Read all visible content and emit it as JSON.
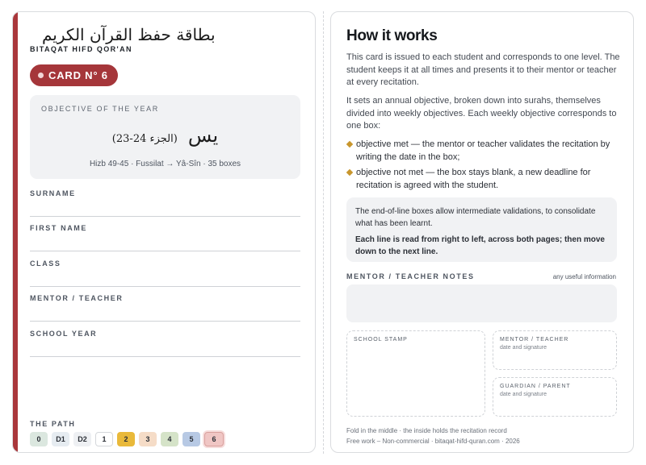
{
  "left_page": {
    "title_arabic": "بطاقة حفظ القرآن الكريم",
    "title_latin": "BITAQAT HIFD QOR'AN",
    "card_label": "CARD N° 6",
    "objective": {
      "label": "OBJECTIVE OF THE YEAR",
      "surah_arabic": "يس",
      "juz_arabic": "(الجزء 24-23)",
      "details": "Hizb 49-45 · Fussilat → Yâ-Sîn · 35 boxes"
    },
    "fields": [
      "SURNAME",
      "FIRST NAME",
      "CLASS",
      "MENTOR / TEACHER",
      "SCHOOL YEAR"
    ],
    "path": {
      "label": "THE PATH",
      "steps": [
        {
          "label": "0",
          "color": "#dbe7df"
        },
        {
          "label": "D1",
          "color": "#e6ecf1"
        },
        {
          "label": "D2",
          "color": "#eef0f3"
        },
        {
          "label": "1",
          "color": "#ffffff"
        },
        {
          "label": "2",
          "color": "#e9b93a"
        },
        {
          "label": "3",
          "color": "#f5dcc7"
        },
        {
          "label": "4",
          "color": "#d5e3c8"
        },
        {
          "label": "5",
          "color": "#b7c9e4"
        },
        {
          "label": "6",
          "color": "#f0c6c4"
        }
      ]
    }
  },
  "right_page": {
    "title": "How it works",
    "para1": "This card is issued to each student and corresponds to one level. The student keeps it at all times and presents it to their mentor or teacher at every recitation.",
    "para2": "It sets an annual objective, broken down into surahs, themselves divided into weekly objectives. Each weekly objective corresponds to one box:",
    "bullets": [
      "objective met — the mentor or teacher validates the recitation by writing the date in the box;",
      "objective not met — the box stays blank, a new deadline for recitation is agreed with the student."
    ],
    "info_line1": "The end-of-line boxes allow intermediate validations, to consolidate what has been learnt.",
    "info_line2": "Each line is read from right to left, across both pages; then move down to the next line.",
    "notes_label": "MENTOR / TEACHER NOTES",
    "notes_hint": "any useful information",
    "stamp_label": "SCHOOL STAMP",
    "mentor_label": "MENTOR / TEACHER",
    "mentor_sub": "date and signature",
    "guardian_label": "GUARDIAN / PARENT",
    "guardian_sub": "date and signature",
    "footer1": "Fold in the middle · the inside holds the recitation record",
    "footer2": "Free work – Non-commercial · bitaqat-hifd-quran.com · 2026"
  },
  "colors": {
    "accent": "#a9373b",
    "bullet": "#c8962d"
  }
}
